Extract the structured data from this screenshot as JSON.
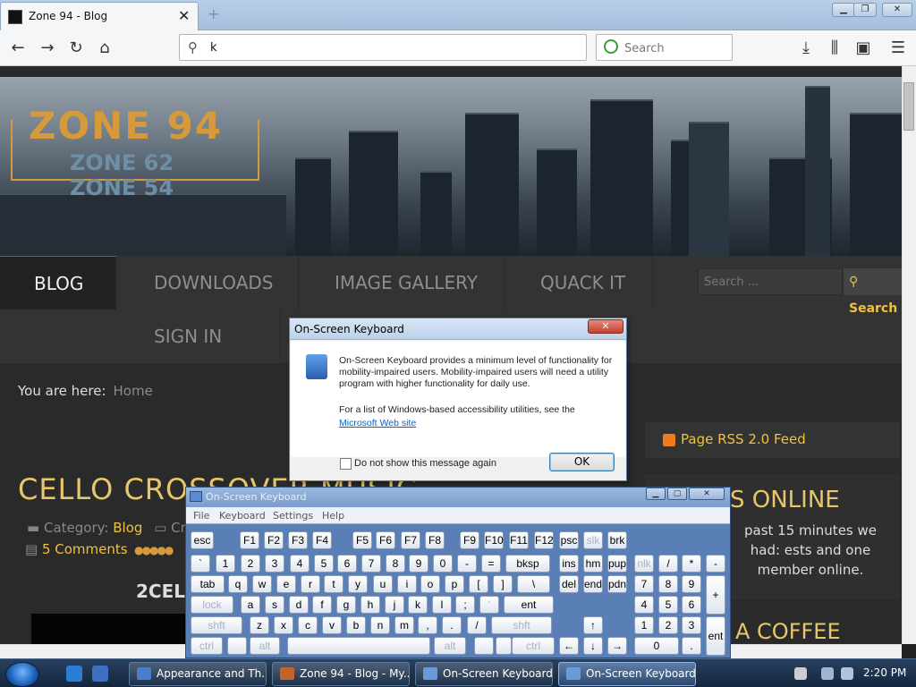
{
  "browser": {
    "tab_title": "Zone 94 - Blog",
    "url_value": "k",
    "search_placeholder": "Search"
  },
  "site": {
    "logo_main": "ZONE 94",
    "logo_sub1": "ZONE 62",
    "logo_sub2": "ZONE 54",
    "menu": [
      "BLOG",
      "DOWNLOADS",
      "IMAGE GALLERY",
      "QUACK IT",
      "SIGN IN"
    ],
    "search_placeholder": "Search ...",
    "search_button": "Search",
    "breadcrumb_label": "You are here:",
    "breadcrumb_home": "Home",
    "post_title": "CELLO CROSSOVER MUSIC - ...",
    "category_label": "Category:",
    "category_value": "Blog",
    "comments": "5 Comments",
    "sub_heading": "2CELL",
    "rss": "Page RSS 2.0 Feed",
    "online_heading": "S ONLINE",
    "online_text": "past 15 minutes we had: ests and one member online.",
    "coffee_heading": "A COFFEE"
  },
  "dialog": {
    "title": "On-Screen Keyboard",
    "message": "On-Screen Keyboard provides a minimum level of functionality for mobility-impaired users. Mobility-impaired users will need a utility program with higher functionality for daily use.",
    "message2": "For a list of Windows-based accessibility utilities, see the",
    "link": "Microsoft Web site",
    "checkbox_label": "Do not show this message again",
    "ok": "OK"
  },
  "osk": {
    "title": "On-Screen Keyboard",
    "menu": [
      "File",
      "Keyboard",
      "Settings",
      "Help"
    ],
    "row1": [
      "esc",
      "F1",
      "F2",
      "F3",
      "F4",
      "F5",
      "F6",
      "F7",
      "F8",
      "F9",
      "F10",
      "F11",
      "F12",
      "psc",
      "slk",
      "brk"
    ],
    "row2": [
      "`",
      "1",
      "2",
      "3",
      "4",
      "5",
      "6",
      "7",
      "8",
      "9",
      "0",
      "-",
      "=",
      "bksp",
      "ins",
      "hm",
      "pup",
      "nlk",
      "/",
      "*",
      "-"
    ],
    "row3": [
      "tab",
      "q",
      "w",
      "e",
      "r",
      "t",
      "y",
      "u",
      "i",
      "o",
      "p",
      "[",
      "]",
      "\\",
      "del",
      "end",
      "pdn",
      "7",
      "8",
      "9",
      "+"
    ],
    "row4": [
      "lock",
      "a",
      "s",
      "d",
      "f",
      "g",
      "h",
      "j",
      "k",
      "l",
      ";",
      "'",
      "ent",
      "4",
      "5",
      "6"
    ],
    "row5": [
      "shft",
      "z",
      "x",
      "c",
      "v",
      "b",
      "n",
      "m",
      ",",
      ".",
      "/",
      "shft",
      "↑",
      "1",
      "2",
      "3",
      "ent"
    ],
    "row6": [
      "ctrl",
      "alt",
      "alt",
      "ctrl",
      "←",
      "↓",
      "→",
      "0",
      "."
    ]
  },
  "taskbar": {
    "items": [
      "Appearance and Th...",
      "Zone 94 - Blog - My...",
      "On-Screen Keyboard",
      "On-Screen Keyboard"
    ],
    "clock": "2:20 PM"
  }
}
